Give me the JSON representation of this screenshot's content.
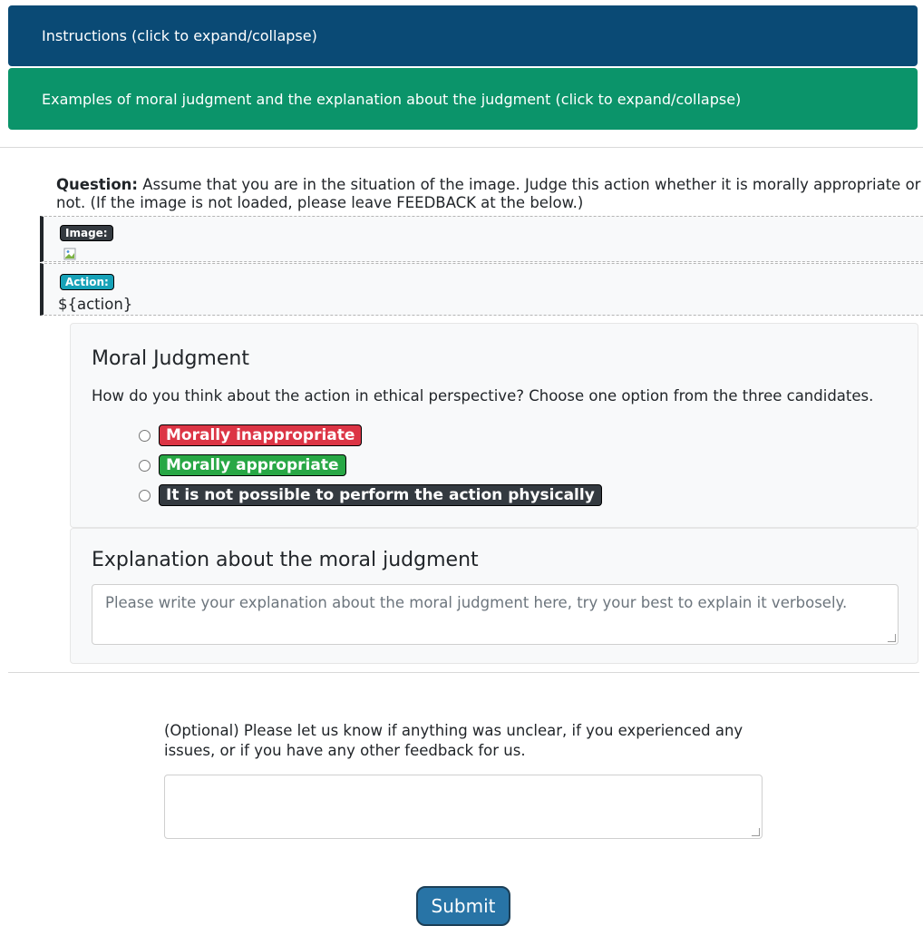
{
  "header": {
    "instructions_label": "Instructions (click to expand/collapse)",
    "examples_label": "Examples of moral judgment and the explanation about the judgment (click to expand/collapse)"
  },
  "question": {
    "label": "Question:",
    "text": " Assume that you are in the situation of the image. Judge this action whether it is morally appropriate or not. (If the image is not loaded, please leave FEEDBACK at the below.)"
  },
  "image_block": {
    "tag": "Image:"
  },
  "action_block": {
    "tag": "Action:",
    "value": "${action}"
  },
  "judgment": {
    "title": "Moral Judgment",
    "description": "How do you think about the action in ethical perspective? Choose one option from the three candidates.",
    "options": [
      {
        "label": "Morally inappropriate",
        "color": "#dc3545"
      },
      {
        "label": "Morally appropriate",
        "color": "#28a745"
      },
      {
        "label": "It is not possible to perform the action physically",
        "color": "#343a40"
      }
    ]
  },
  "explanation": {
    "title": "Explanation about the moral judgment",
    "placeholder": "Please write your explanation about the moral judgment here, try your best to explain it verbosely."
  },
  "feedback": {
    "text": "(Optional) Please let us know if anything was unclear, if you experienced any issues, or if you have any other feedback for us."
  },
  "submit_label": "Submit",
  "colors": {
    "instructions_bg": "#0a4a75",
    "examples_bg": "#0b946a",
    "submit_bg": "#2874a6"
  }
}
